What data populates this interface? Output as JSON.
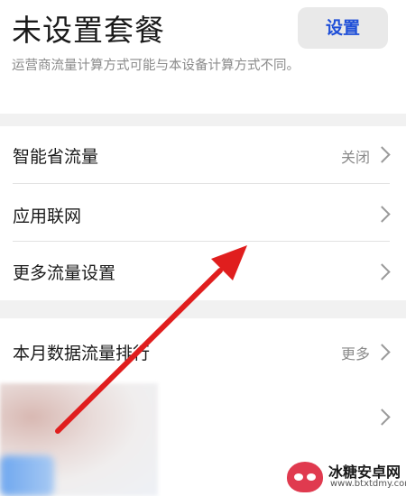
{
  "header": {
    "title": "未设置套餐",
    "setup_button": "设置",
    "subtitle": "运营商流量计算方式可能与本设备计算方式不同。"
  },
  "settings": {
    "items": [
      {
        "label": "智能省流量",
        "value": "关闭"
      },
      {
        "label": "应用联网",
        "value": ""
      },
      {
        "label": "更多流量设置",
        "value": ""
      }
    ]
  },
  "ranking": {
    "label": "本月数据流量排行",
    "value": "更多"
  },
  "watermark": {
    "name": "冰糖安卓网",
    "url": "www.btxtdmy.com"
  },
  "colors": {
    "accent_blue": "#1f4fd8",
    "arrow_red": "#e01e1e",
    "section_gap": "#f1f1f1"
  }
}
